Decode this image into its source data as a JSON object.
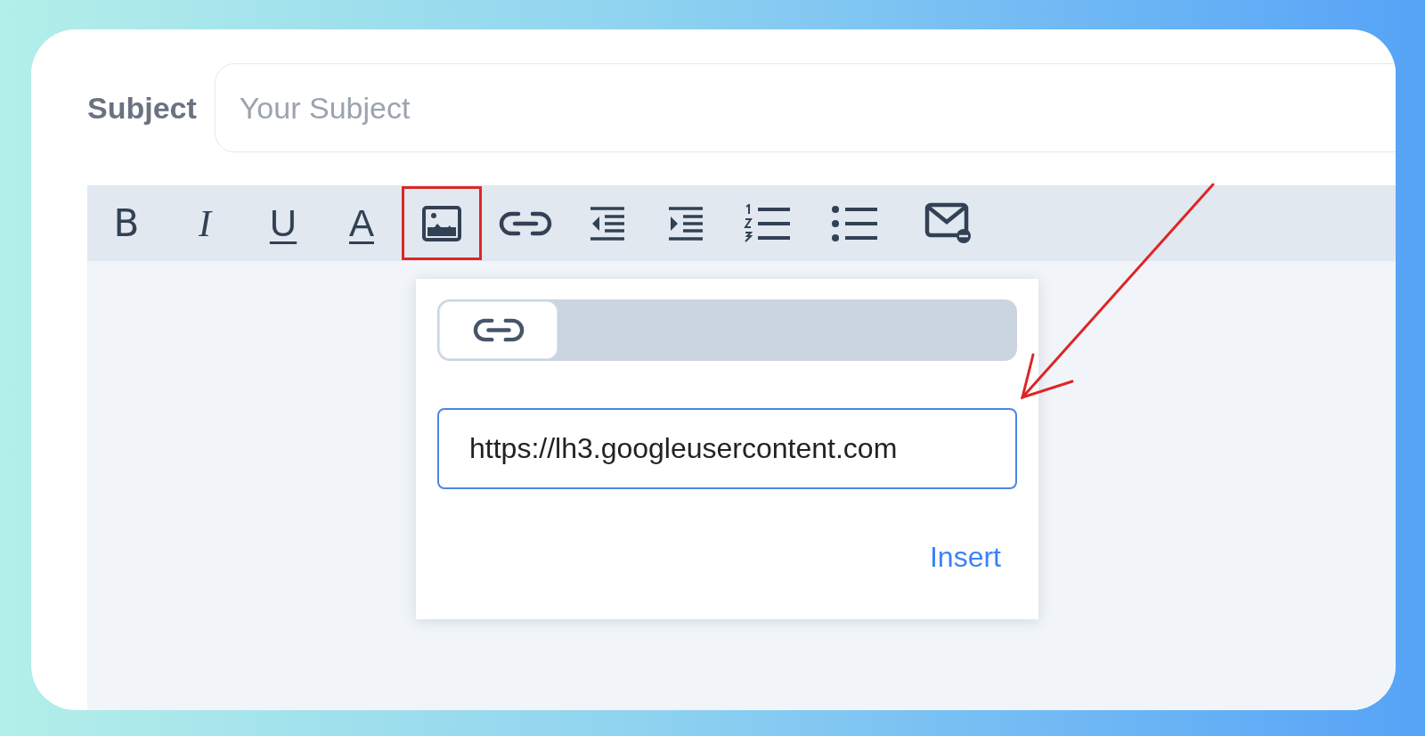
{
  "subject": {
    "label": "Subject",
    "placeholder": "Your Subject"
  },
  "toolbar": [
    {
      "kind": "bold",
      "label": "B",
      "highlighted": false
    },
    {
      "kind": "italic",
      "label": "I",
      "highlighted": false
    },
    {
      "kind": "underline",
      "label": "U",
      "highlighted": false
    },
    {
      "kind": "text-color",
      "label": "A",
      "highlighted": false
    },
    {
      "kind": "image",
      "highlighted": true
    },
    {
      "kind": "link",
      "highlighted": false
    },
    {
      "kind": "outdent",
      "highlighted": false
    },
    {
      "kind": "indent",
      "highlighted": false
    },
    {
      "kind": "ordered-list",
      "highlighted": false
    },
    {
      "kind": "bullet-list",
      "highlighted": false
    },
    {
      "kind": "email",
      "highlighted": false
    }
  ],
  "image_popup": {
    "tabs": [
      {
        "kind": "link",
        "selected": true
      }
    ],
    "url_field": {
      "value": "https://lh3.googleusercontent.com"
    },
    "insert_button": "Insert"
  },
  "annotation": {
    "kind": "arrow"
  }
}
